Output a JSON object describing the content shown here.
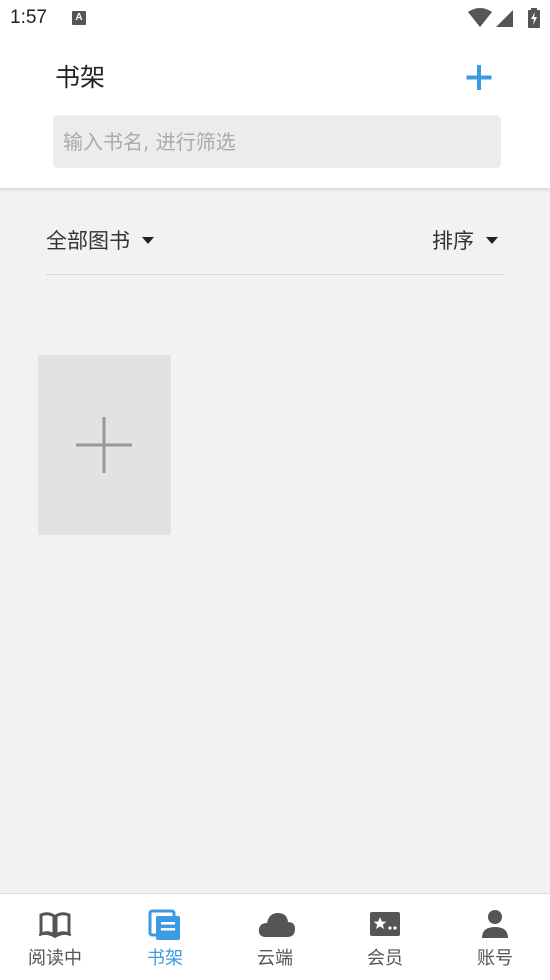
{
  "status_bar": {
    "time": "1:57",
    "app_icon_letter": "A",
    "icons": [
      "wifi-icon",
      "signal-icon",
      "battery-charging-icon"
    ]
  },
  "header": {
    "title": "书架",
    "add_icon": "plus-icon",
    "search_placeholder": "输入书名, 进行筛选"
  },
  "filter": {
    "category_label": "全部图书",
    "sort_label": "排序"
  },
  "bookshelf": {
    "add_tile_icon": "plus-icon"
  },
  "bottom_nav": {
    "items": [
      {
        "label": "阅读中",
        "icon": "open-book-icon",
        "active": false
      },
      {
        "label": "书架",
        "icon": "bookshelf-icon",
        "active": true
      },
      {
        "label": "云端",
        "icon": "cloud-icon",
        "active": false
      },
      {
        "label": "会员",
        "icon": "member-card-icon",
        "active": false
      },
      {
        "label": "账号",
        "icon": "person-icon",
        "active": false
      }
    ]
  },
  "colors": {
    "accent": "#3c9be0",
    "background": "#f2f2f2",
    "header_bg": "#ffffff",
    "tile_bg": "#e2e2e2"
  }
}
